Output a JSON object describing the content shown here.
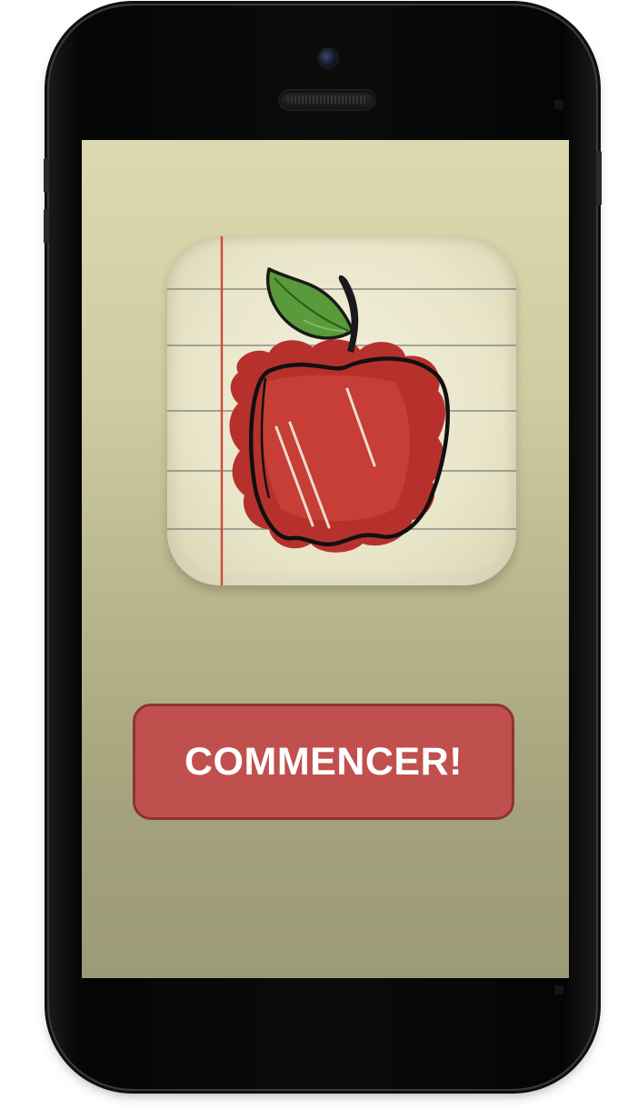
{
  "device": {
    "frame_color": "#0b0b0c",
    "screen_gradient_top": "#dcd9ae",
    "screen_gradient_bottom": "#9c9b77"
  },
  "splash": {
    "logo_icon": "apple-notebook-icon",
    "start_button": {
      "label": "COMMENCER!",
      "color": "#c0504d",
      "border_color": "#8c3432"
    }
  }
}
